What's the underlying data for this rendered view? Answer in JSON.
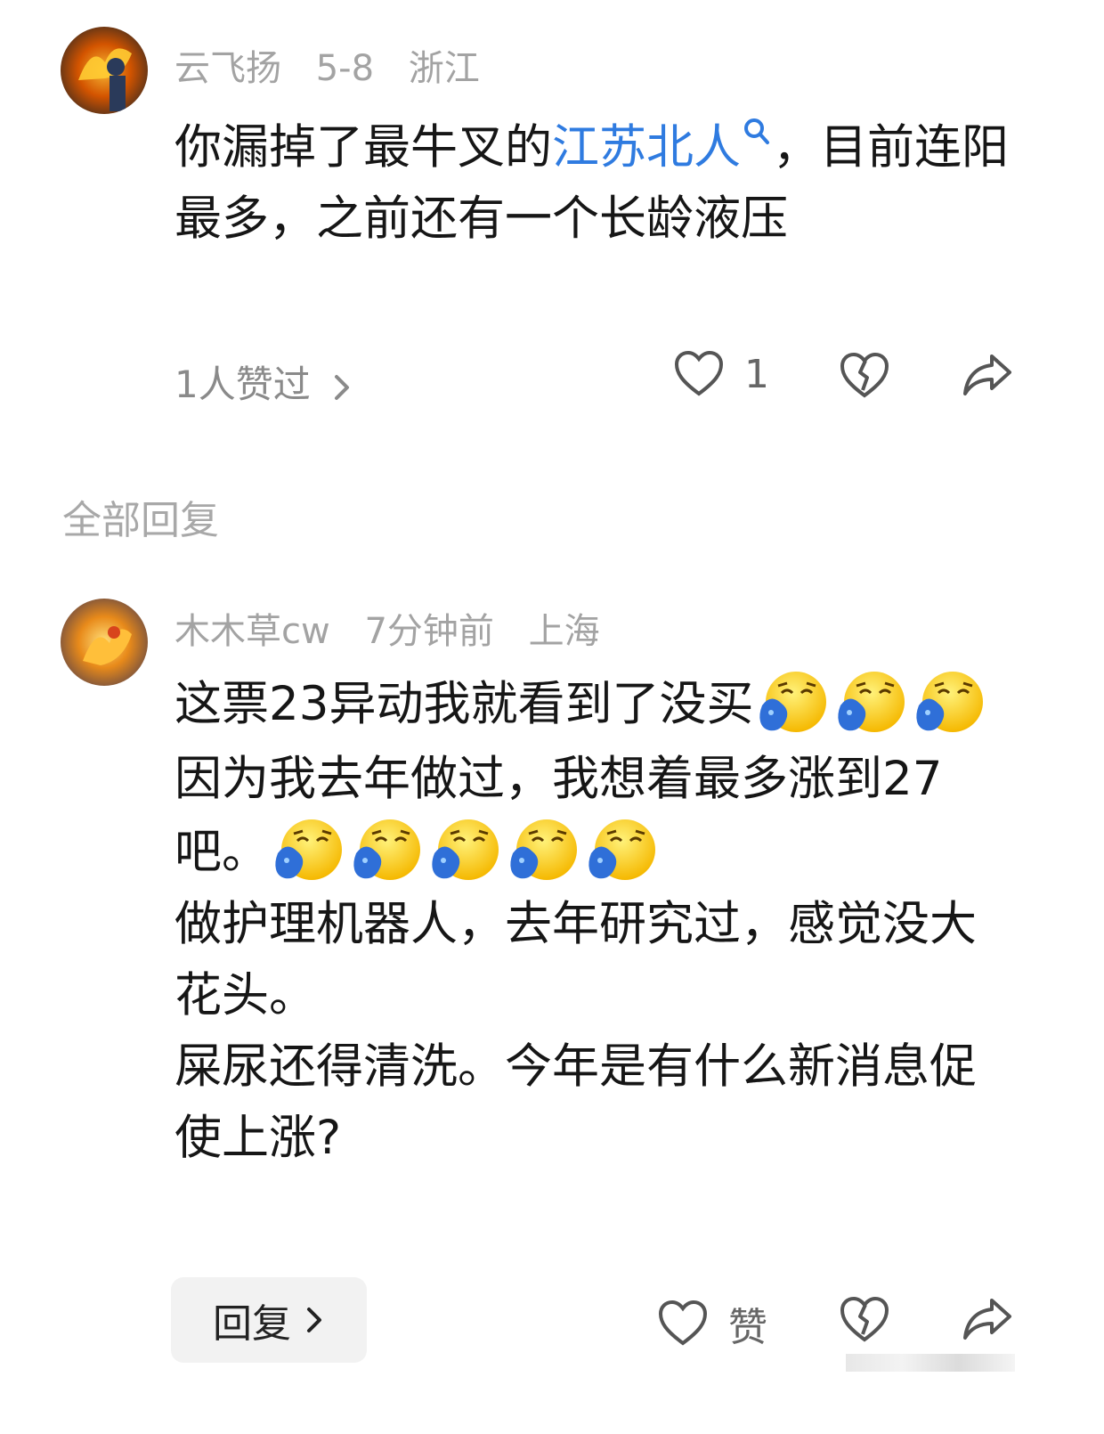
{
  "main_comment": {
    "author": "云飞扬",
    "date": "5-8",
    "location": "浙江",
    "text_before": "你漏掉了最牛叉的",
    "link_text": "江苏北人",
    "text_after": "，目前连阳最多，之前还有一个长龄液压",
    "likes_summary": "1人赞过",
    "like_count": "1",
    "icons": [
      "heart-icon",
      "broken-heart-icon",
      "share-icon",
      "chevron-right-icon",
      "search-icon"
    ]
  },
  "section_title": "全部回复",
  "reply": {
    "author": "木木草cw",
    "time": "7分钟前",
    "location": "上海",
    "line1": "这票23异动我就看到了没买",
    "line1_emoji_count": 3,
    "line2": "因为我去年做过，我想着最多涨到27吧。",
    "line2_emoji_count": 5,
    "line3": "做护理机器人，去年研究过，感觉没大花头。",
    "line4": "屎尿还得清洗。今年是有什么新消息促使上涨?",
    "reply_button": "回复",
    "like_label": "赞",
    "emoji_name": "crying-emoji"
  },
  "colors": {
    "link": "#2f7be0",
    "meta": "#a3a3a3",
    "text": "#161616"
  }
}
